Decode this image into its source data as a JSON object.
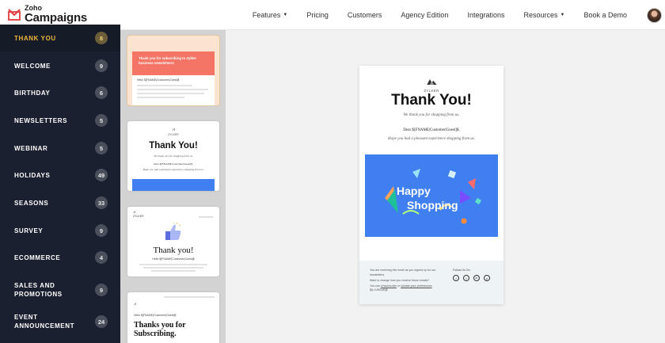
{
  "header": {
    "logo_zoho": "Zoho",
    "logo_campaigns": "Campaigns",
    "nav": [
      {
        "label": "Features",
        "has_caret": true
      },
      {
        "label": "Pricing",
        "has_caret": false
      },
      {
        "label": "Customers",
        "has_caret": false
      },
      {
        "label": "Agency Edition",
        "has_caret": false
      },
      {
        "label": "Integrations",
        "has_caret": false
      },
      {
        "label": "Resources",
        "has_caret": true
      },
      {
        "label": "Book a Demo",
        "has_caret": false
      }
    ]
  },
  "sidebar": {
    "items": [
      {
        "label": "THANK YOU",
        "count": "8",
        "active": true
      },
      {
        "label": "WELCOME",
        "count": "9"
      },
      {
        "label": "BIRTHDAY",
        "count": "6"
      },
      {
        "label": "NEWSLETTERS",
        "count": "5"
      },
      {
        "label": "WEBINAR",
        "count": "5"
      },
      {
        "label": "HOLIDAYS",
        "count": "49"
      },
      {
        "label": "SEASONS",
        "count": "33"
      },
      {
        "label": "SURVEY",
        "count": "9"
      },
      {
        "label": "ECOMMERCE",
        "count": "4"
      },
      {
        "label": "SALES AND PROMOTIONS",
        "count": "9"
      },
      {
        "label": "EVENT ANNOUNCEMENT",
        "count": "24"
      }
    ]
  },
  "thumbs": {
    "t1": {
      "banner": "Thank you for subscribing to Zylker business newsletters!",
      "greeting": "Hello $[FNAME|Customer|Guest]$"
    },
    "t2": {
      "brand": "ZYLKER",
      "title": "Thank You!",
      "sub": "We thank you for shopping from us.",
      "dear": "Dear $[FNAME|Customer|Guest]$,",
      "hope": "Hope you had a pleasant experience shopping from us."
    },
    "t3": {
      "brand": "ZYLKER",
      "title": "Thank you!",
      "greeting": "Hello $[FNAME|Customer|Guest]$"
    },
    "t4": {
      "title": "Thanks you for Subscribing.",
      "greeting": "Hello $[FNAME|Customer|Guest]$"
    }
  },
  "preview": {
    "brand": "ZYLKER",
    "title": "Thank You!",
    "subtitle": "We thank you for shopping from us.",
    "dear": "Dear $[FNAME|Customer|Guest]$,",
    "hope": "Hope you had a pleasant experience shopping from us.",
    "banner_word1": "Happy",
    "banner_word2": "Shopping",
    "footer": {
      "line1": "You are receiving this email as you signed up for our newsletters.",
      "line2": "Want to change how you receive these emails?",
      "line3_prefix": "You can",
      "unsubscribe": "Unsubscribe",
      "or": "or",
      "update": "Update your preferences",
      "code": "$[LI:UNSUB]$",
      "follow": "Follow Us On",
      "social": [
        "f",
        "t",
        "in",
        "p"
      ]
    }
  },
  "colors": {
    "sidebar_bg": "#1b2030",
    "active_text": "#f0b63a",
    "banner_red": "#f47466",
    "banner_blue": "#3f7ff0"
  }
}
